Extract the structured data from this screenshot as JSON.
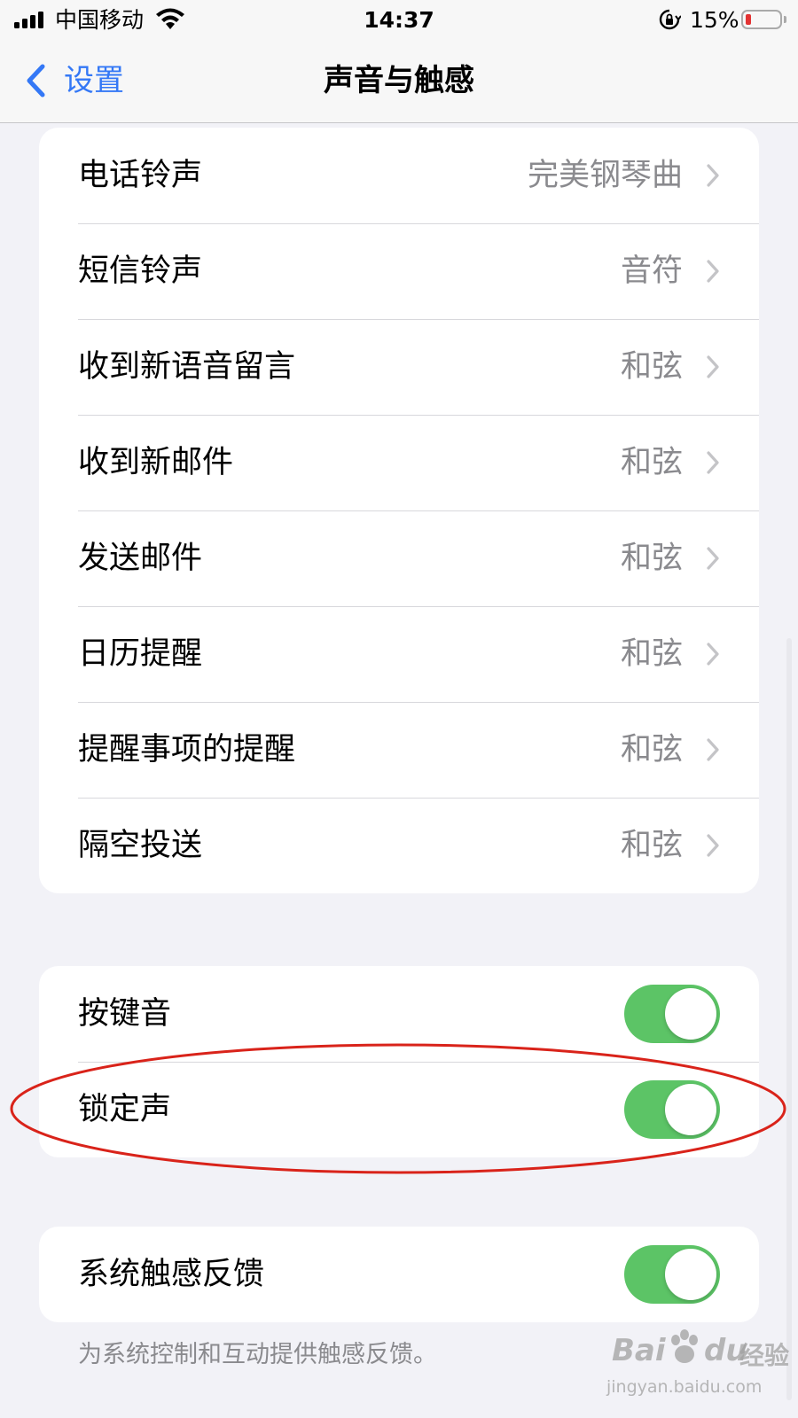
{
  "status_bar": {
    "carrier": "中国移动",
    "time": "14:37",
    "battery_percent": "15%",
    "battery_level": 0.15,
    "battery_color": "#e33333",
    "icons": [
      "signal-icon",
      "wifi-icon",
      "orientation-lock-icon",
      "battery-icon"
    ]
  },
  "nav": {
    "back_label": "设置",
    "title": "声音与触感",
    "accent_color": "#3478f6"
  },
  "sounds": [
    {
      "label": "电话铃声",
      "value": "完美钢琴曲"
    },
    {
      "label": "短信铃声",
      "value": "音符"
    },
    {
      "label": "收到新语音留言",
      "value": "和弦"
    },
    {
      "label": "收到新邮件",
      "value": "和弦"
    },
    {
      "label": "发送邮件",
      "value": "和弦"
    },
    {
      "label": "日历提醒",
      "value": "和弦"
    },
    {
      "label": "提醒事项的提醒",
      "value": "和弦"
    },
    {
      "label": "隔空投送",
      "value": "和弦"
    }
  ],
  "toggles": {
    "keyboard_clicks": {
      "label": "按键音",
      "on": true
    },
    "lock_sound": {
      "label": "锁定声",
      "on": true
    }
  },
  "haptics": {
    "label": "系统触感反馈",
    "on": true,
    "footnote": "为系统控制和互动提供触感反馈。"
  },
  "toggle_on_color": "#5cc466",
  "annotation_color": "#d9231a",
  "watermark": {
    "brand": "Bai du 经验",
    "url": "jingyan.baidu.com"
  }
}
